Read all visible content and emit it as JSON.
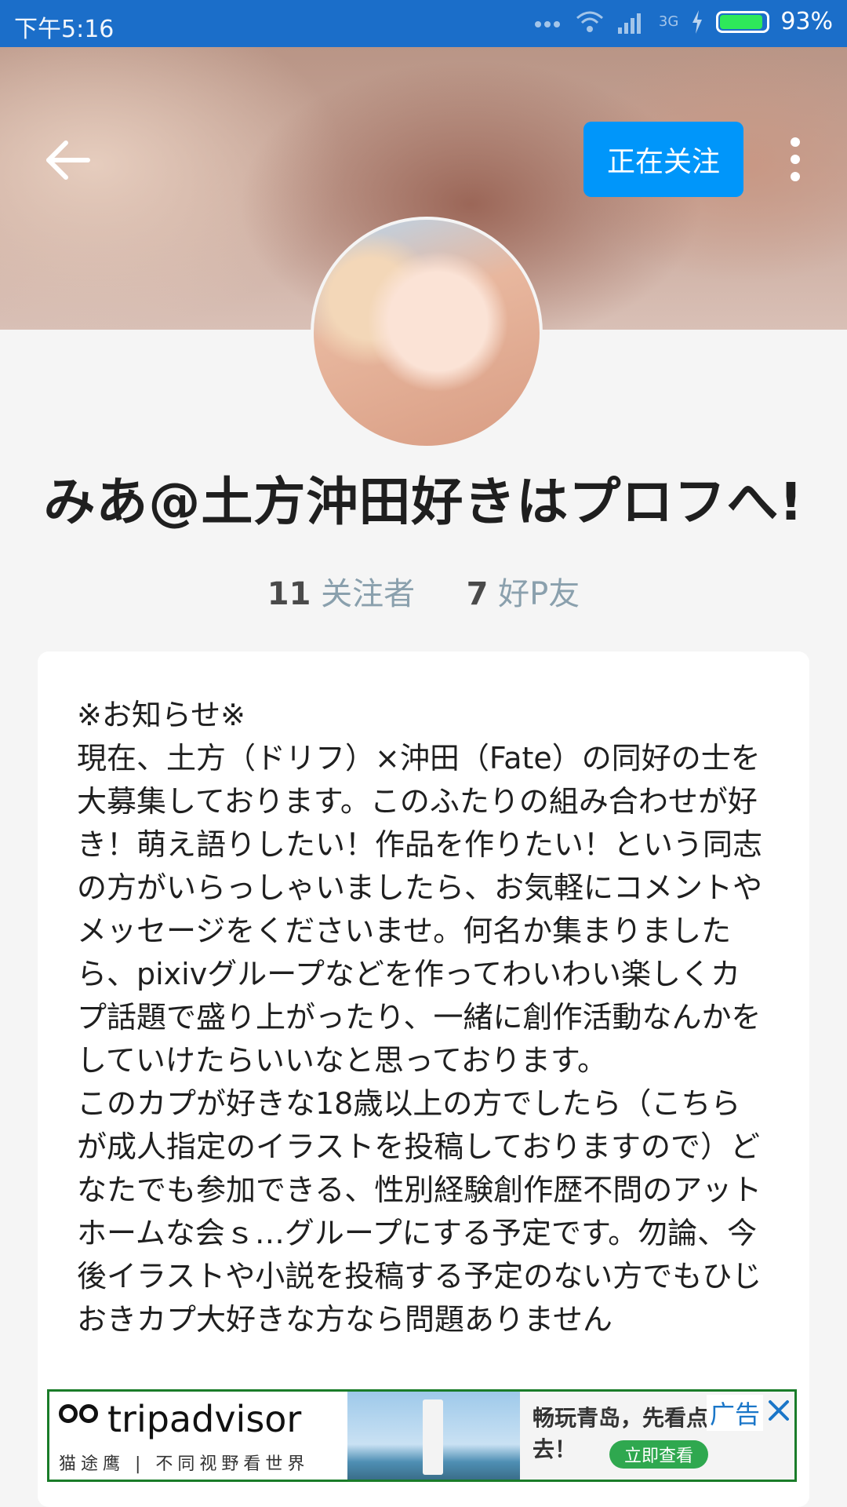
{
  "status_bar": {
    "time": "下午5:16",
    "network": "3G",
    "battery": "93%",
    "battery_level": 0.93
  },
  "header": {
    "back_icon": "arrow-left-icon",
    "follow_label": "正在关注",
    "more_icon": "more-vertical-icon"
  },
  "profile": {
    "name": "みあ@土方沖田好きはプロフへ!",
    "followers_count": "11",
    "followers_label": "关注者",
    "friends_count": "7",
    "friends_label": "好P友",
    "bio": "※お知らせ※\n現在、土方（ドリフ）×沖田（Fate）の同好の士を大募集しております。このふたりの組み合わせが好き！萌え語りしたい！作品を作りたい！という同志の方がいらっしゃいましたら、お気軽にコメントやメッセージをくださいませ。何名か集まりましたら、pixivグループなどを作ってわいわい楽しくカプ話題で盛り上がったり、一緒に創作活動なんかをしていけたらいいなと思っております。\nこのカプが好きな18歳以上の方でしたら（こちらが成人指定のイラストを投稿しておりますので）どなたでも参加できる、性別経験創作歴不問のアットホームな会ｓ…グループにする予定です。勿論、今後イラストや小説を投稿する予定のない方でもひじおきカプ大好きな方なら問題ありません"
  },
  "ad": {
    "brand": "tripadvisor",
    "brand_sub": "猫途鹰 | 不同视野看世界",
    "headline": "畅玩青岛，先看点评再去！",
    "cta": "立即查看",
    "tag": "广告",
    "close_icon": "close-icon",
    "accent": "#1a7c29"
  },
  "colors": {
    "status_bar": "#1b6ec9",
    "follow_button": "#0096fa",
    "stats_label": "#8aa0ad"
  }
}
